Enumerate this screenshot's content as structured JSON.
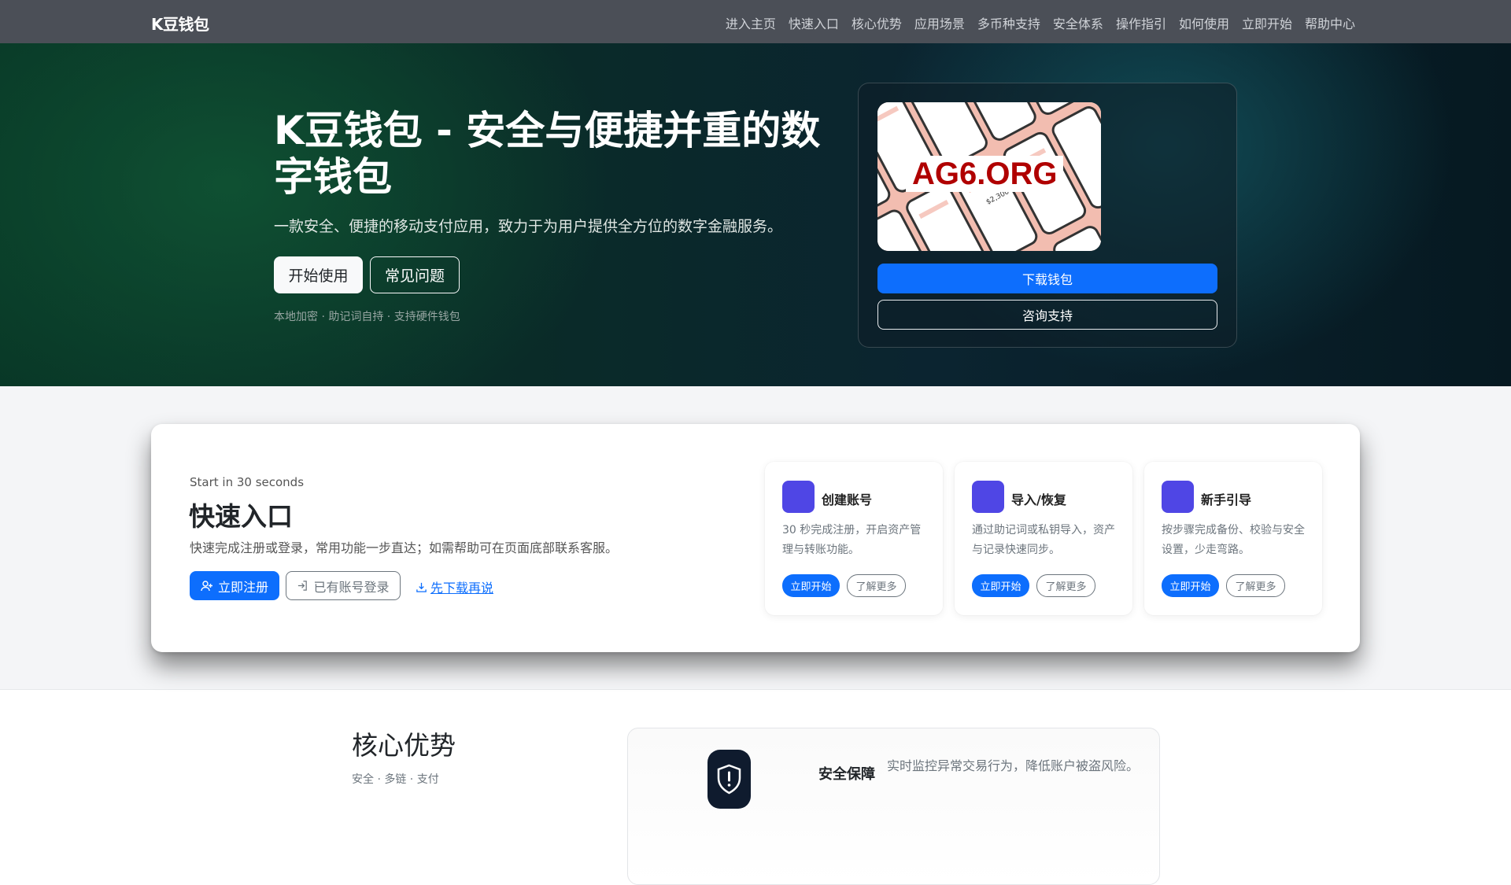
{
  "navbar": {
    "brand": "K豆钱包",
    "links": [
      "进入主页",
      "快速入口",
      "核心优势",
      "应用场景",
      "多币种支持",
      "安全体系",
      "操作指引",
      "如何使用",
      "立即开始",
      "帮助中心"
    ]
  },
  "hero": {
    "title": "K豆钱包 - 安全与便捷并重的数字钱包",
    "subtitle": "一款安全、便捷的移动支付应用，致力于为用户提供全方位的数字金融服务。",
    "primary_button": "开始使用",
    "secondary_button": "常见问题",
    "note": "本地加密 · 助记词自持 · 支持硬件钱包",
    "card": {
      "watermark": "AG6.ORG",
      "phone_amount": "$2,300",
      "download_button": "下载钱包",
      "support_button": "咨询支持"
    }
  },
  "quick": {
    "eyebrow": "Start in 30 seconds",
    "title": "快速入口",
    "description": "快速完成注册或登录，常用功能一步直达；如需帮助可在页面底部联系客服。",
    "register_button": "立即注册",
    "login_button": "已有账号登录",
    "download_link": "先下载再说",
    "features": [
      {
        "title": "创建账号",
        "desc": "30 秒完成注册，开启资产管理与转账功能。",
        "primary": "立即开始",
        "secondary": "了解更多"
      },
      {
        "title": "导入/恢复",
        "desc": "通过助记词或私钥导入，资产与记录快速同步。",
        "primary": "立即开始",
        "secondary": "了解更多"
      },
      {
        "title": "新手引导",
        "desc": "按步骤完成备份、校验与安全设置，少走弯路。",
        "primary": "立即开始",
        "secondary": "了解更多"
      }
    ]
  },
  "core": {
    "title": "核心优势",
    "subtitle": "安全 · 多链 · 支付",
    "item_title": "安全保障",
    "item_desc": "实时监控异常交易行为，降低账户被盗风险。"
  },
  "icons": [
    "person-plus-icon",
    "login-icon",
    "download-icon",
    "shield-exclamation-icon"
  ],
  "colors": {
    "primary": "#0d6efd",
    "feature_icon": "#4f46e5",
    "navbar": "#4b4f57"
  }
}
